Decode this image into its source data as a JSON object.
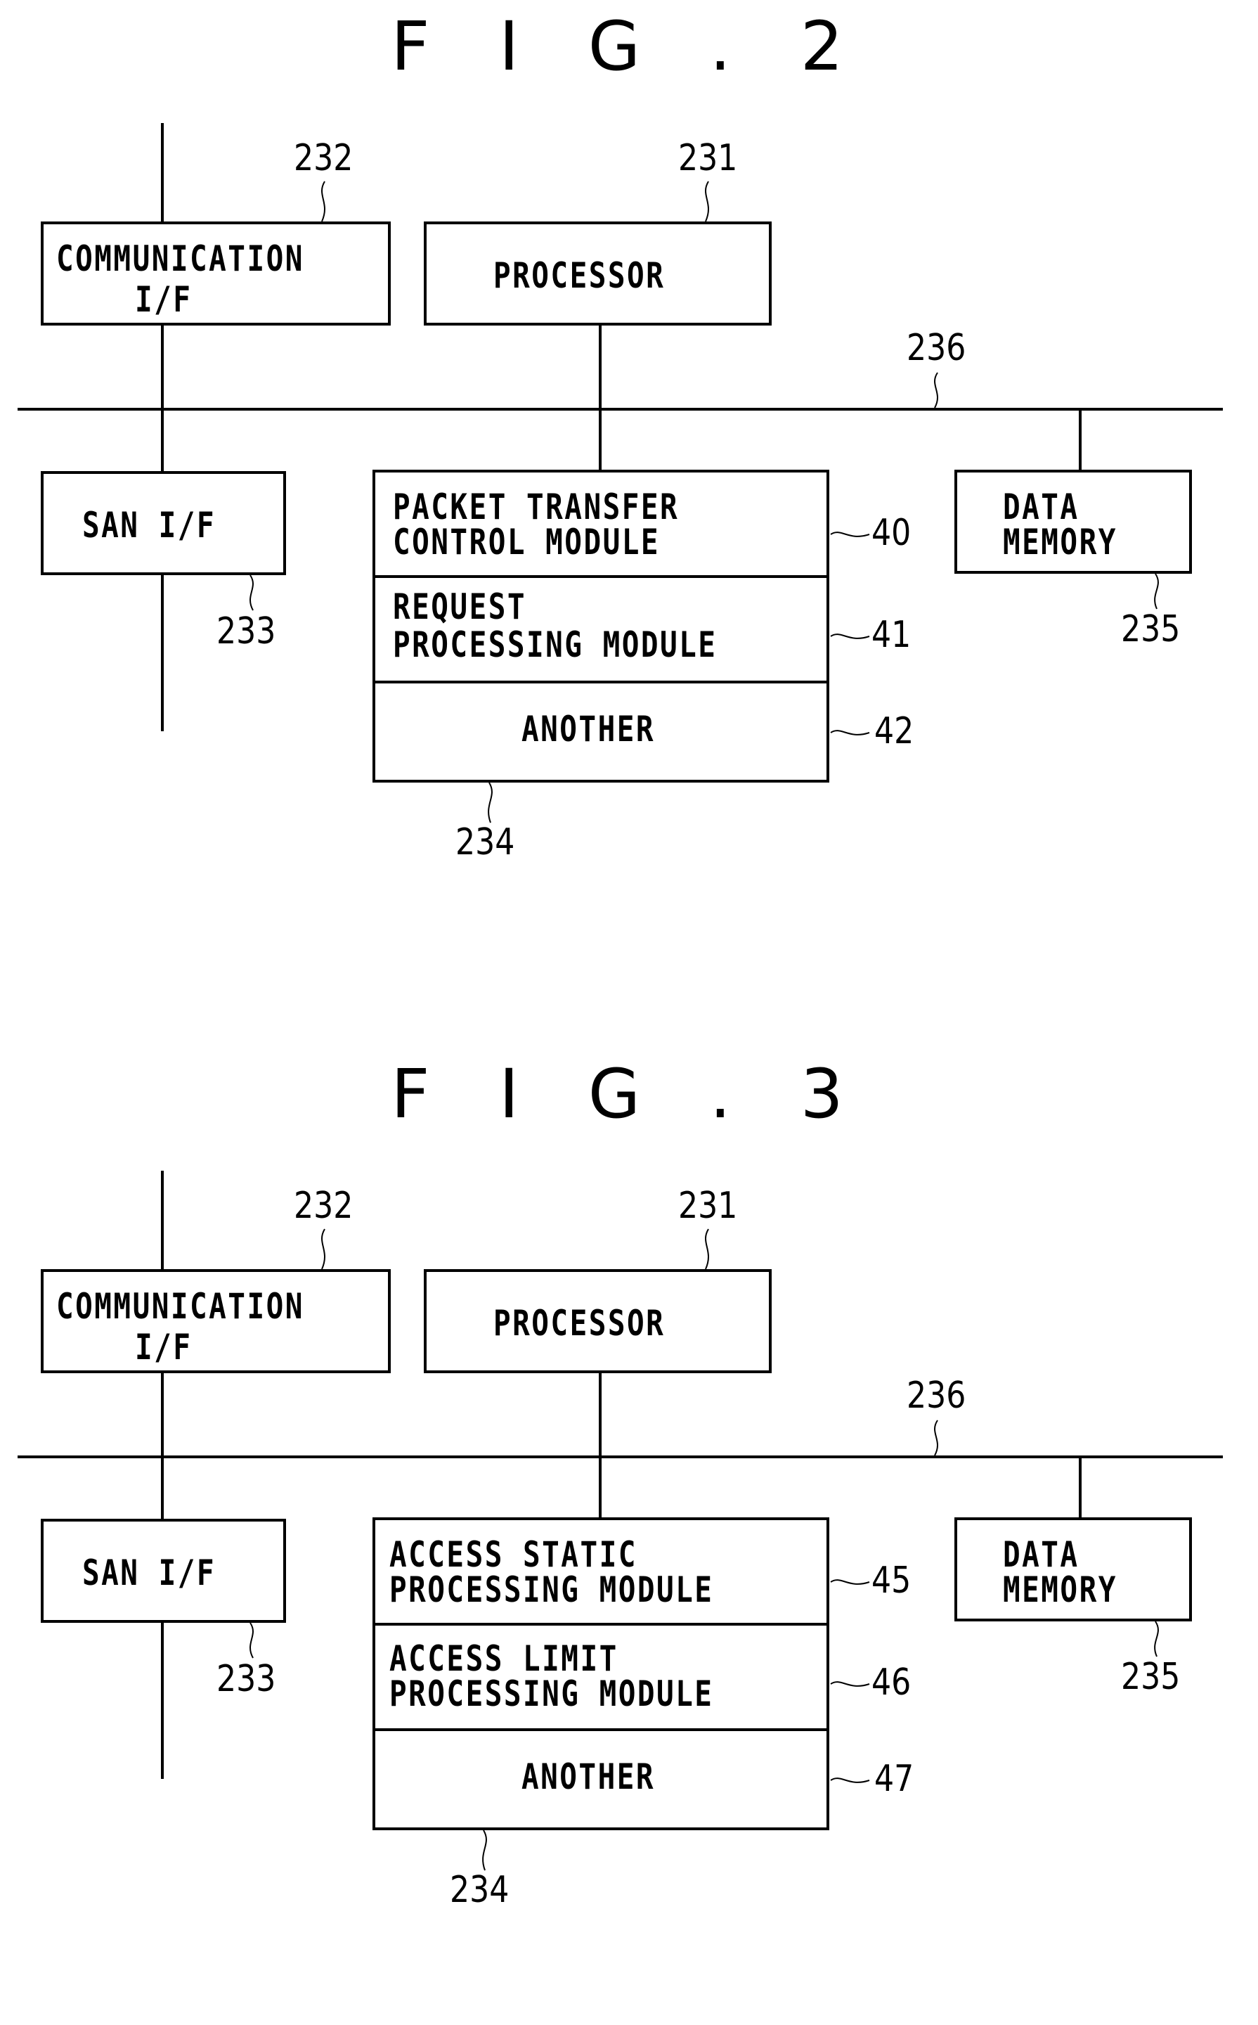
{
  "figures": [
    {
      "title": "F I G . 2",
      "communication_if": {
        "label_line1": "COMMUNICATION",
        "label_line2": "I/F",
        "ref": "232"
      },
      "processor": {
        "label": "PROCESSOR",
        "ref": "231"
      },
      "bus": {
        "ref": "236"
      },
      "san_if": {
        "label": "SAN I/F",
        "ref": "233"
      },
      "module_stack": {
        "ref": "234",
        "modules": [
          {
            "line1": "PACKET TRANSFER",
            "line2": "CONTROL MODULE",
            "ref": "40"
          },
          {
            "line1": "REQUEST",
            "line2": "PROCESSING MODULE",
            "ref": "41"
          },
          {
            "line1": "ANOTHER",
            "line2": "",
            "ref": "42"
          }
        ]
      },
      "data_memory": {
        "label_line1": "DATA",
        "label_line2": "MEMORY",
        "ref": "235"
      }
    },
    {
      "title": "F I G . 3",
      "communication_if": {
        "label_line1": "COMMUNICATION",
        "label_line2": "I/F",
        "ref": "232"
      },
      "processor": {
        "label": "PROCESSOR",
        "ref": "231"
      },
      "bus": {
        "ref": "236"
      },
      "san_if": {
        "label": "SAN I/F",
        "ref": "233"
      },
      "module_stack": {
        "ref": "234",
        "modules": [
          {
            "line1": "ACCESS STATIC",
            "line2": "PROCESSING MODULE",
            "ref": "45"
          },
          {
            "line1": "ACCESS LIMIT",
            "line2": "PROCESSING MODULE",
            "ref": "46"
          },
          {
            "line1": "ANOTHER",
            "line2": "",
            "ref": "47"
          }
        ]
      },
      "data_memory": {
        "label_line1": "DATA",
        "label_line2": "MEMORY",
        "ref": "235"
      }
    }
  ]
}
